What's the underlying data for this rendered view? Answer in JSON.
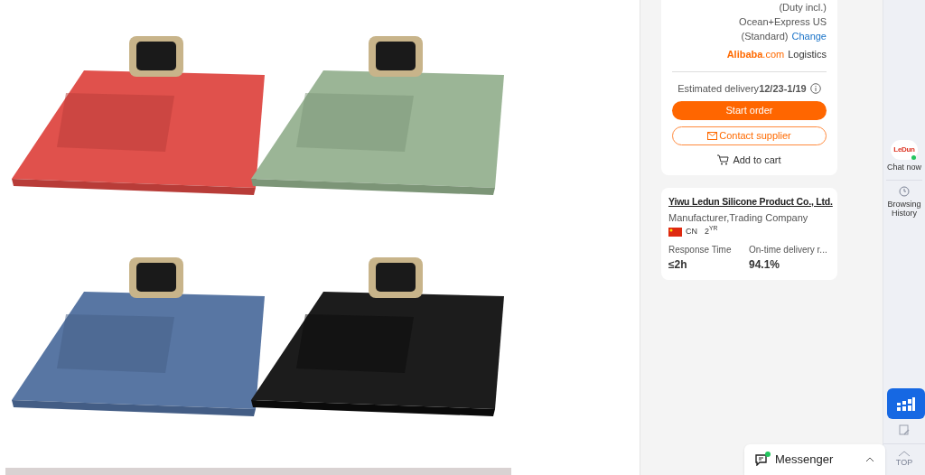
{
  "shipping": {
    "duty_note": "(Duty incl.)",
    "method": "Ocean+Express US",
    "method_detail": "(Standard)",
    "change_link": "Change",
    "logistics_brand": "Alibaba",
    "logistics_brand_suffix": ".com",
    "logistics_label": "Logistics"
  },
  "delivery": {
    "label": "Estimated delivery",
    "dates": "12/23-1/19"
  },
  "actions": {
    "start_order": "Start order",
    "contact_supplier": "Contact supplier",
    "add_to_cart": "Add to cart"
  },
  "supplier": {
    "name": "Yiwu Ledun Silicone Product Co., Ltd.",
    "type": "Manufacturer,Trading Company",
    "country": "CN",
    "years": "2",
    "years_unit": "YR",
    "stats": [
      {
        "label": "Response Time",
        "value": "≤2h"
      },
      {
        "label": "On-time delivery r...",
        "value": "94.1%"
      }
    ]
  },
  "side_rail": {
    "chat": {
      "logo": "LeDun",
      "label": "Chat now",
      "online": true
    },
    "history": "Browsing History",
    "top": "TOP"
  },
  "messenger": {
    "label": "Messenger",
    "unread": true
  }
}
